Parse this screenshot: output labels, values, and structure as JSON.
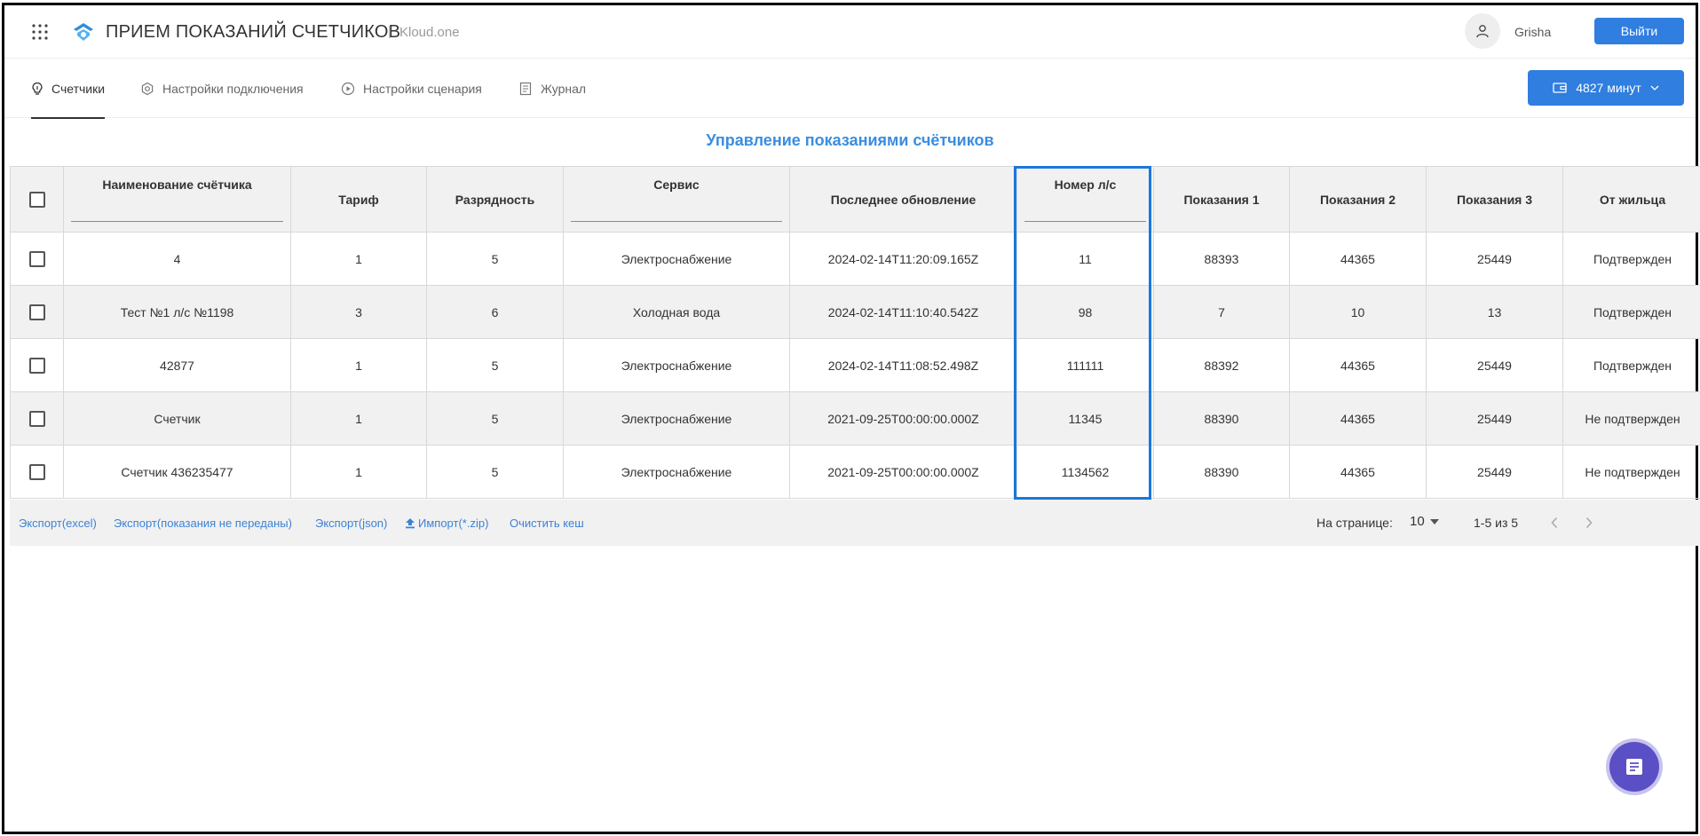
{
  "header": {
    "title": "ПРИЕМ ПОКАЗАНИЙ СЧЕТЧИКОВ",
    "separator": "|",
    "brand": "Kloud.one",
    "user": "Grisha",
    "logout_label": "Выйти"
  },
  "tabs": [
    {
      "label": "Счетчики",
      "icon": "lightbulb-icon",
      "active": true
    },
    {
      "label": "Настройки подключения",
      "icon": "hexagon-settings-icon",
      "active": false
    },
    {
      "label": "Настройки сценария",
      "icon": "play-circle-icon",
      "active": false
    },
    {
      "label": "Журнал",
      "icon": "journal-icon",
      "active": false
    }
  ],
  "minutes_button": {
    "label": "4827 минут",
    "icon": "wallet-icon"
  },
  "page_title": "Управление показаниями счётчиков",
  "table": {
    "columns": [
      "Наименование счётчика",
      "Тариф",
      "Разрядность",
      "Сервис",
      "Последнее обновление",
      "Номер л/с",
      "Показания 1",
      "Показания 2",
      "Показания 3",
      "От жильца"
    ],
    "rows": [
      [
        "4",
        "1",
        "5",
        "Электроснабжение",
        "2024-02-14T11:20:09.165Z",
        "11",
        "88393",
        "44365",
        "25449",
        "Подтвержден"
      ],
      [
        "Тест №1 л/с №1198",
        "3",
        "6",
        "Холодная вода",
        "2024-02-14T11:10:40.542Z",
        "98",
        "7",
        "10",
        "13",
        "Подтвержден"
      ],
      [
        "42877",
        "1",
        "5",
        "Электроснабжение",
        "2024-02-14T11:08:52.498Z",
        "111111",
        "88392",
        "44365",
        "25449",
        "Подтвержден"
      ],
      [
        "Счетчик",
        "1",
        "5",
        "Электроснабжение",
        "2021-09-25T00:00:00.000Z",
        "11345",
        "88390",
        "44365",
        "25449",
        "Не подтвержден"
      ],
      [
        "Счетчик 436235477",
        "1",
        "5",
        "Электроснабжение",
        "2021-09-25T00:00:00.000Z",
        "1134562",
        "88390",
        "44365",
        "25449",
        "Не подтвержден"
      ]
    ]
  },
  "footer": {
    "export_excel": "Экспорт(excel)",
    "export_not_sent": "Экспорт(показания не переданы)",
    "export_json": "Экспорт(json)",
    "import_zip": "Импорт(*.zip)",
    "clear_cache": "Очистить кеш",
    "per_page_label": "На странице:",
    "per_page_value": "10",
    "range": "1-5 из 5"
  },
  "colors": {
    "primary": "#2f7ee0",
    "title_blue": "#3b8de0",
    "highlight": "#1a78dd",
    "fab": "#5a4fc4"
  }
}
